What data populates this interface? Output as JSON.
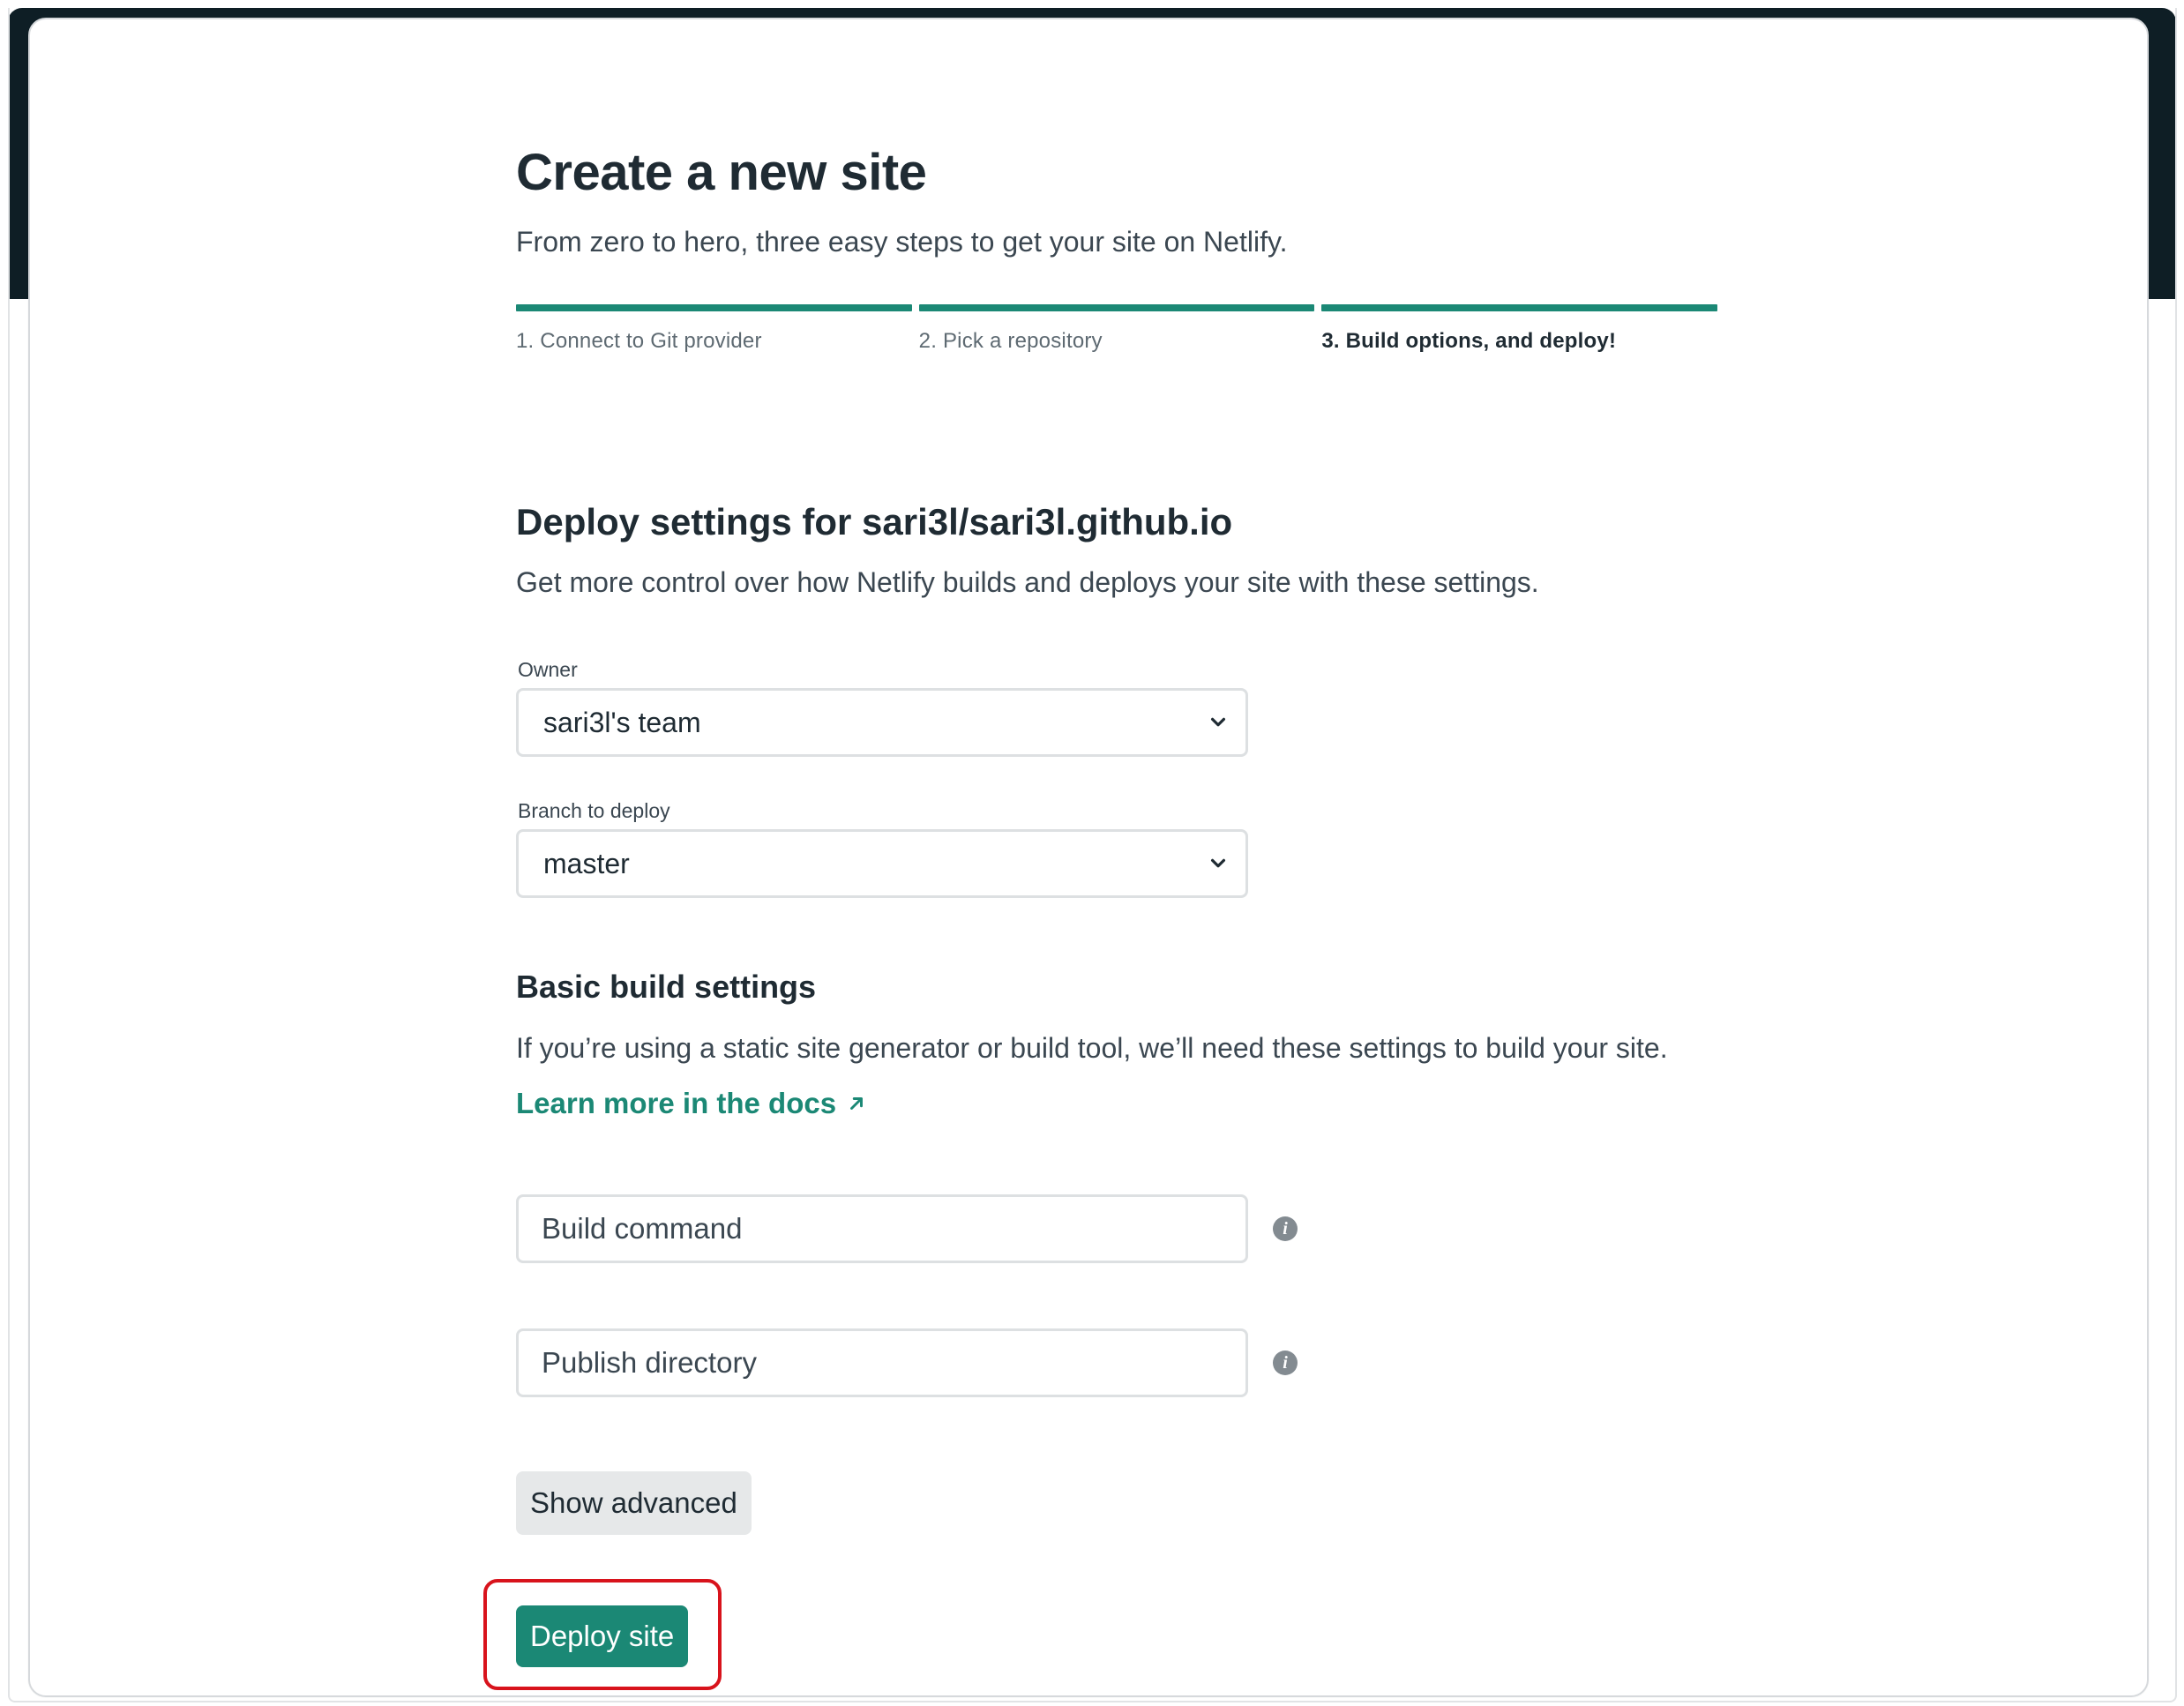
{
  "header": {
    "title": "Create a new site",
    "subtitle": "From zero to hero, three easy steps to get your site on Netlify."
  },
  "steps": [
    {
      "label": "1. Connect to Git provider",
      "active": false
    },
    {
      "label": "2. Pick a repository",
      "active": false
    },
    {
      "label": "3. Build options, and deploy!",
      "active": true
    }
  ],
  "deploy_settings": {
    "title": "Deploy settings for sari3l/sari3l.github.io",
    "description": "Get more control over how Netlify builds and deploys your site with these settings.",
    "owner": {
      "label": "Owner",
      "value": "sari3l's team"
    },
    "branch": {
      "label": "Branch to deploy",
      "value": "master"
    }
  },
  "build_settings": {
    "title": "Basic build settings",
    "description": "If you’re using a static site generator or build tool, we’ll need these settings to build your site.",
    "docs_link": "Learn more in the docs",
    "build_command": {
      "placeholder": "Build command",
      "value": ""
    },
    "publish_directory": {
      "placeholder": "Publish directory",
      "value": ""
    }
  },
  "actions": {
    "show_advanced": "Show advanced",
    "deploy": "Deploy site"
  },
  "colors": {
    "accent": "#1b8875",
    "header_dark": "#0e1e25",
    "highlight": "#d8131c"
  },
  "icons": {
    "select_chevron": "chevron-down-icon",
    "info": "info-icon",
    "external_link": "arrow-up-right-icon"
  }
}
